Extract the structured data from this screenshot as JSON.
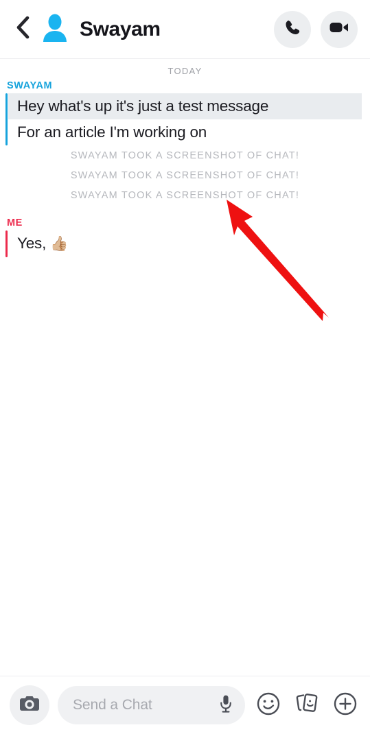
{
  "header": {
    "back_icon": "chevron-left-icon",
    "avatar_icon": "default-avatar-icon",
    "title": "Swayam",
    "call_icon": "phone-icon",
    "video_icon": "video-camera-icon",
    "avatar_color": "#1ab4f0",
    "title_color": "#15151b",
    "button_bg": "#eceef0"
  },
  "chat": {
    "day_divider": "TODAY",
    "groups": [
      {
        "sender": "SWAYAM",
        "sender_color": "#16a3dc",
        "accent_color": "#16a3dc",
        "lines": [
          {
            "text": "Hey what's up it's just a test message",
            "highlight": true
          },
          {
            "text": "For an article I'm working on",
            "highlight": false
          }
        ]
      }
    ],
    "system_notes": [
      "SWAYAM TOOK A SCREENSHOT OF CHAT!",
      "SWAYAM TOOK A SCREENSHOT OF CHAT!",
      "SWAYAM TOOK A SCREENSHOT OF CHAT!"
    ],
    "note_color": "#b6b8bd",
    "me_group": {
      "sender": "ME",
      "sender_color": "#ec2a4c",
      "accent_color": "#ec2a4c",
      "text": "Yes,",
      "emoji": "👍🏼"
    },
    "highlight_color": "#e9ecef"
  },
  "annotation": {
    "arrow_color": "#ee1111",
    "arrow_name": "red-pointer-arrow"
  },
  "composer": {
    "camera_icon": "camera-icon",
    "placeholder": "Send a Chat",
    "mic_icon": "microphone-icon",
    "emoji_icon": "smiley-face-icon",
    "sticker_icon": "sticker-cards-icon",
    "plus_icon": "plus-circle-icon",
    "pill_bg": "#f0f1f3",
    "icon_color": "#4a4d55"
  }
}
